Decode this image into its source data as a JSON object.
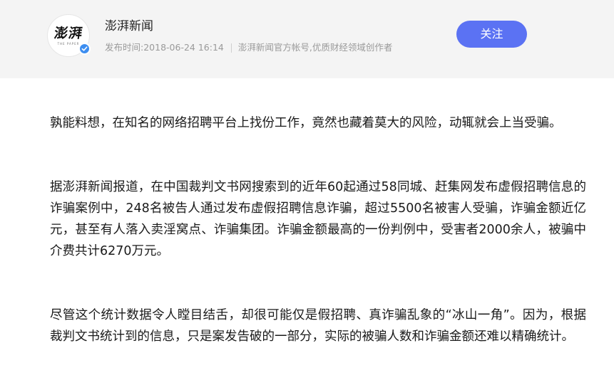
{
  "header": {
    "avatar_logo": "澎湃",
    "avatar_sub": "THE PAPER",
    "author_name": "澎湃新闻",
    "publish_label": "发布时间: ",
    "publish_time": "2018-06-24 16:14",
    "description": "澎湃新闻官方帐号,优质财经领域创作者",
    "follow_label": "关注",
    "colors": {
      "follow_bg": "#5b72f3",
      "verified_badge": "#3d8ef0",
      "header_bg": "#f4f4f4"
    },
    "icons": {
      "verified": "verified-badge-icon"
    }
  },
  "article": {
    "paragraphs": [
      "孰能料想，在知名的网络招聘平台上找份工作，竟然也藏着莫大的风险，动辄就会上当受骗。",
      "据澎湃新闻报道，在中国裁判文书网搜索到的近年60起通过58同城、赶集网发布虚假招聘信息的诈骗案例中，248名被告人通过发布虚假招聘信息诈骗，超过5500名被害人受骗，诈骗金额近亿元，甚至有人落入卖淫窝点、诈骗集团。诈骗金额最高的一份判例中，受害者2000余人，被骗中介费共计6270万元。",
      "尽管这个统计数据令人瞠目结舌，却很可能仅是假招聘、真诈骗乱象的“冰山一角”。因为，根据裁判文书统计到的信息，只是案发告破的一部分，实际的被骗人数和诈骗金额还难以精确统计。"
    ]
  }
}
